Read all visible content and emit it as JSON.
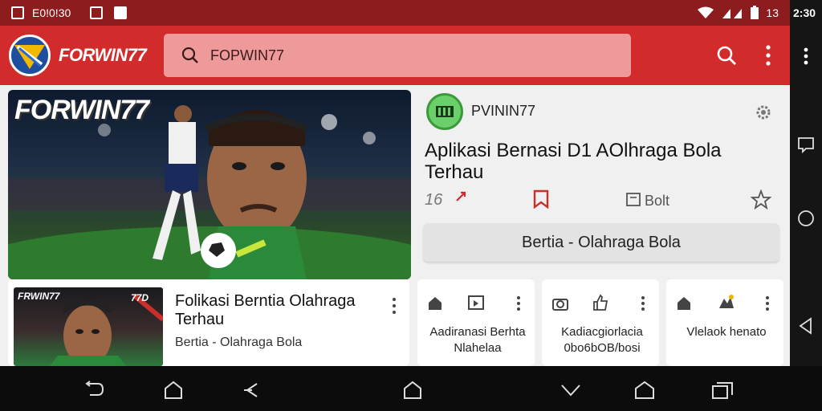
{
  "status_bar": {
    "left_text": "E0!0!30",
    "right_text": "13"
  },
  "nav_right": {
    "time": "2:30"
  },
  "app_bar": {
    "brand": "FORWIN77",
    "search_value": "FOPWIN77"
  },
  "hero": {
    "title": "FORWIN77"
  },
  "post": {
    "author": "PVININ77",
    "title": "Aplikasi Bernasi D1 AOlhraga Bola Terhau",
    "count": "16",
    "bolt_label": "Bolt",
    "pill_label": "Bertia - Olahraga Bola"
  },
  "article": {
    "thumb_title": "FRWIN77",
    "thumb_badge": "77D",
    "title": "Folikasi Berntia Olahraga Terhau",
    "subtitle": "Bertia - Olahraga Bola"
  },
  "minis": [
    {
      "text": "Aadiranasi Berhta Nlahelaa"
    },
    {
      "text": "Kadiacgiorlacia 0bo6bOB/bosi"
    },
    {
      "text": "Vlelaok henato"
    }
  ],
  "colors": {
    "primary": "#d12b2c",
    "status": "#8c1c1e",
    "search": "#ef9a9a",
    "bookmark": "#c9302c"
  }
}
